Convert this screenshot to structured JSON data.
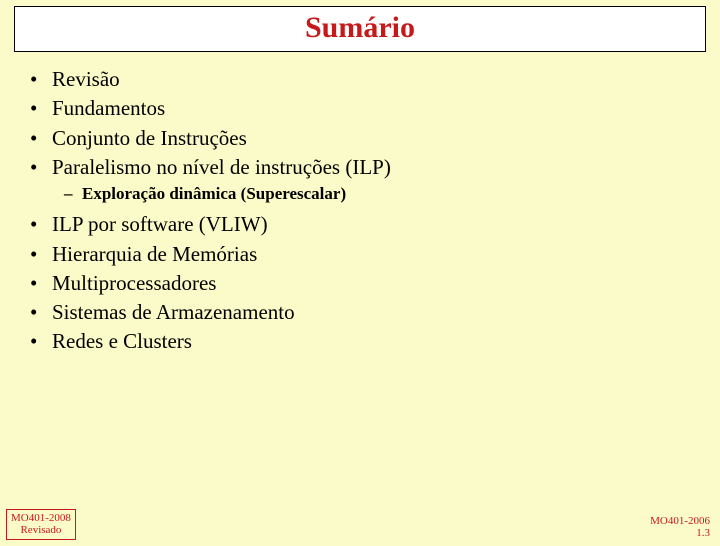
{
  "title": "Sumário",
  "items_top": [
    "Revisão",
    "Fundamentos",
    "Conjunto de Instruções",
    "Paralelismo no nível de instruções (ILP)"
  ],
  "subitem": "Exploração dinâmica (Superescalar)",
  "items_bottom": [
    "ILP por software (VLIW)",
    "Hierarquia de Memórias",
    "Multiprocessadores",
    "Sistemas de Armazenamento",
    "Redes e Clusters"
  ],
  "footer_left_line1": "MO401-2008",
  "footer_left_line2": "Revisado",
  "footer_right_line1": "MO401-2006",
  "footer_right_line2": "1.3"
}
